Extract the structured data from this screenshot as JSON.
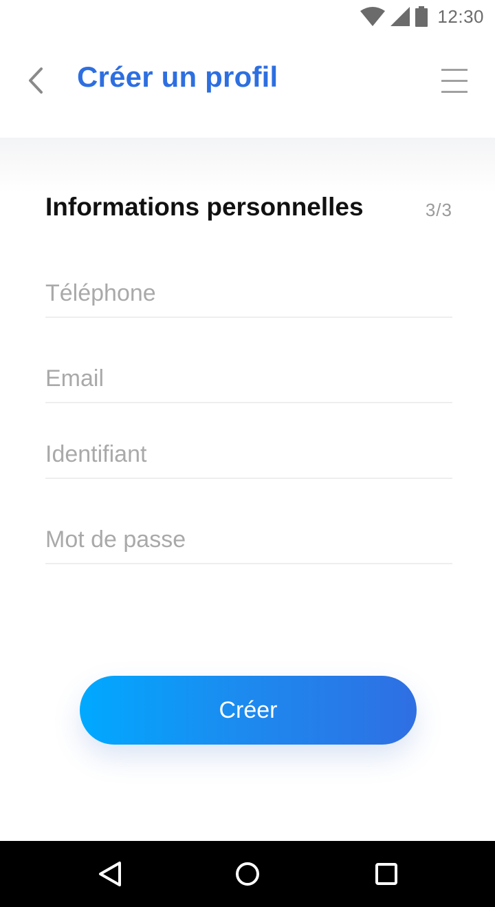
{
  "status_bar": {
    "time": "12:30",
    "icons": [
      "wifi-icon",
      "signal-icon",
      "battery-icon"
    ]
  },
  "app_bar": {
    "title": "Créer un profil",
    "back_icon": "chevron-left-icon",
    "menu_icon": "hamburger-menu-icon"
  },
  "form": {
    "section_title": "Informations personnelles",
    "step": "3/3",
    "fields": [
      {
        "placeholder": "Téléphone",
        "value": ""
      },
      {
        "placeholder": "Email",
        "value": ""
      },
      {
        "placeholder": "Identifiant",
        "value": ""
      },
      {
        "placeholder": "Mot de passe",
        "value": ""
      }
    ],
    "submit_label": "Créer"
  },
  "nav_bar": {
    "icons": [
      "back-triangle-icon",
      "home-circle-icon",
      "recents-square-icon"
    ]
  },
  "colors": {
    "accent": "#2d6fe0",
    "button_gradient_start": "#00a9ff",
    "button_gradient_end": "#2f6fe3",
    "placeholder": "#a9a9a9",
    "divider": "#eeeeee"
  }
}
